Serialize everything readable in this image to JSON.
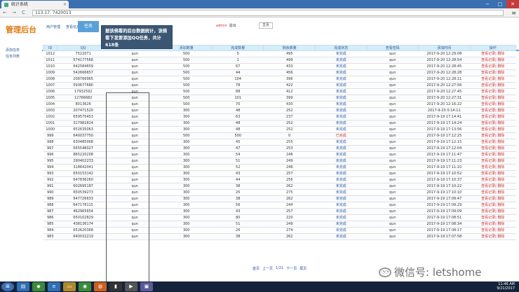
{
  "browser": {
    "tab_title": "统计系统",
    "address": "113.17.              7420013",
    "back": "←",
    "forward": "→",
    "reload": "C",
    "menu": "≡",
    "win_min": "−",
    "win_max": "□",
    "win_close": "✕"
  },
  "header": {
    "brand": "管理后台",
    "nav": [
      "用户管理",
      "查看信息"
    ],
    "active_tab": "任务",
    "user": "admin",
    "logout": "退出",
    "home": "主页"
  },
  "sidebar": {
    "items": [
      "添加任务",
      "任务列表"
    ]
  },
  "table": {
    "headers": [
      "ID",
      "QQ",
      "",
      "添加数量",
      "完成数量",
      "剩余数量",
      "完成状态",
      "查看密码",
      "添加时间",
      "操作"
    ],
    "rows": [
      [
        "1012",
        "7522071",
        "qun",
        "500",
        "5",
        "495",
        "未完成",
        "qun",
        "2017-9-20 12:29:08",
        "查看记录| 删除"
      ],
      [
        "1011",
        "574177568",
        "qun",
        "500",
        "1",
        "499",
        "未完成",
        "qun",
        "2017-9-20 12:28:54",
        "查看记录| 删除"
      ],
      [
        "1010",
        "642584659",
        "qun",
        "500",
        "67",
        "433",
        "未完成",
        "qun",
        "2017-9-20 12:28:45",
        "查看记录| 删除"
      ],
      [
        "1009",
        "542666657",
        "qun",
        "500",
        "44",
        "456",
        "未完成",
        "qun",
        "2017-9-20 12:28:28",
        "查看记录| 删除"
      ],
      [
        "1008",
        "208766965",
        "qun",
        "500",
        "104",
        "396",
        "未完成",
        "qun",
        "2017-9-20 12:28:11",
        "查看记录| 删除"
      ],
      [
        "1007",
        "593677680",
        "qun",
        "500",
        "78",
        "422",
        "未完成",
        "qun",
        "2017-9-20 12:27:56",
        "查看记录| 删除"
      ],
      [
        "1006",
        "17932592",
        "qun",
        "500",
        "88",
        "412",
        "未完成",
        "qun",
        "2017-9-20 12:27:45",
        "查看记录| 删除"
      ],
      [
        "1005",
        "12766682",
        "qun",
        "500",
        "101",
        "399",
        "未完成",
        "qun",
        "2017-9-20 12:27:31",
        "查看记录| 删除"
      ],
      [
        "1004",
        "8013626",
        "qun",
        "500",
        "70",
        "430",
        "未完成",
        "qun",
        "2017-9-20 12:16:22",
        "查看记录| 删除"
      ],
      [
        "1003",
        "207471520",
        "qun",
        "300",
        "48",
        "252",
        "未完成",
        "qun",
        "2017-9-20 0:14:11",
        "查看记录| 删除"
      ],
      [
        "1002",
        "659570453",
        "qun",
        "300",
        "63",
        "237",
        "未完成",
        "qun",
        "2017-9-19 17:14:41",
        "查看记录| 删除"
      ],
      [
        "1001",
        "317982824",
        "qun",
        "300",
        "48",
        "252",
        "未完成",
        "qun",
        "2017-9-19 17:14:24",
        "查看记录| 删除"
      ],
      [
        "1000",
        "652635063",
        "qun",
        "300",
        "48",
        "252",
        "未完成",
        "qun",
        "2017-9-19 17:13:56",
        "查看记录| 删除"
      ],
      [
        "999",
        "640037750",
        "qun",
        "500",
        "500",
        "0",
        "已完成",
        "qun",
        "2017-9-19 17:12:25",
        "查看记录| 删除"
      ],
      [
        "998",
        "630485068",
        "qun",
        "300",
        "45",
        "255",
        "未完成",
        "qun",
        "2017-9-19 17:12:15",
        "查看记录| 删除"
      ],
      [
        "997",
        "655548027",
        "qun",
        "300",
        "47",
        "253",
        "未完成",
        "qun",
        "2017-9-19 17:12:04",
        "查看记录| 删除"
      ],
      [
        "996",
        "865220208",
        "qun",
        "300",
        "54",
        "246",
        "未完成",
        "qun",
        "2017-9-19 17:11:47",
        "查看记录| 删除"
      ],
      [
        "995",
        "290402233",
        "qun",
        "300",
        "51",
        "249",
        "未完成",
        "qun",
        "2017-9-19 17:11:23",
        "查看记录| 删除"
      ],
      [
        "994",
        "318642041",
        "qun",
        "300",
        "52",
        "248",
        "未完成",
        "qun",
        "2017-9-19 17:11:10",
        "查看记录| 删除"
      ],
      [
        "993",
        "650153142",
        "qun",
        "300",
        "43",
        "257",
        "未完成",
        "qun",
        "2017-9-19 17:10:52",
        "查看记录| 删除"
      ],
      [
        "992",
        "647836260",
        "qun",
        "300",
        "44",
        "256",
        "未完成",
        "qun",
        "2017-9-19 17:10:37",
        "查看记录| 删除"
      ],
      [
        "991",
        "602695187",
        "qun",
        "300",
        "38",
        "262",
        "未完成",
        "qun",
        "2017-9-19 17:10:22",
        "查看记录| 删除"
      ],
      [
        "990",
        "650539273",
        "qun",
        "300",
        "25",
        "275",
        "未完成",
        "qun",
        "2017-9-19 17:10:10",
        "查看记录| 删除"
      ],
      [
        "989",
        "647726633",
        "qun",
        "300",
        "38",
        "262",
        "未完成",
        "qun",
        "2017-9-19 17:09:47",
        "查看记录| 删除"
      ],
      [
        "988",
        "647178115",
        "qun",
        "300",
        "56",
        "244",
        "未完成",
        "qun",
        "2017-9-19 17:09:29",
        "查看记录| 删除"
      ],
      [
        "987",
        "462965654",
        "qun",
        "300",
        "43",
        "257",
        "未完成",
        "qun",
        "2017-9-19 17:09:09",
        "查看记录| 删除"
      ],
      [
        "986",
        "650102829",
        "qun",
        "300",
        "80",
        "220",
        "未完成",
        "qun",
        "2017-9-19 17:08:51",
        "查看记录| 删除"
      ],
      [
        "985",
        "438136174",
        "qun",
        "300",
        "51",
        "249",
        "未完成",
        "qun",
        "2017-9-19 17:08:34",
        "查看记录| 删除"
      ],
      [
        "984",
        "652620368",
        "qun",
        "300",
        "26",
        "274",
        "未完成",
        "qun",
        "2017-9-19 17:08:17",
        "查看记录| 删除"
      ],
      [
        "983",
        "640032219",
        "qun",
        "300",
        "38",
        "262",
        "未完成",
        "qun",
        "2017-9-19 17:07:58",
        "查看记录| 删除"
      ]
    ]
  },
  "pager": [
    "首页",
    "上一页",
    "1/21",
    "下一页",
    "尾页"
  ],
  "callout": "据该佛看的后台数据统计，该佛看下发要添加QQ任务，共计618条",
  "watermark": "微信号: letshome",
  "taskbar": {
    "time": "11:46 AM",
    "date": "9/21/2017"
  },
  "colors": {
    "brand": "#e07a10",
    "accent": "#5aa0d8",
    "link": "#2a5aa0",
    "alert": "#cc3333",
    "popup_bg": "#3b5673"
  }
}
